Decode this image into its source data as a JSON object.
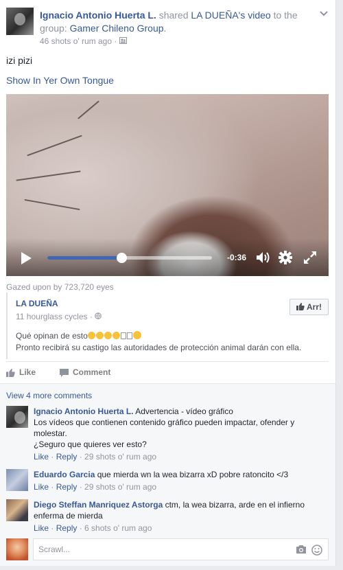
{
  "header": {
    "author": "Ignacio Antonio Huerta L.",
    "shared_word": " shared ",
    "source_name": "LA DUEÑA",
    "source_suffix": "'s video",
    "to_group_text": " to the group: ",
    "group_name": "Gamer Chileno Group",
    "period": ".",
    "timestamp": "46 shots o' rum ago",
    "separator": " · "
  },
  "post": {
    "message": "izi pizi",
    "translate_link": "Show In Yer Own Tongue"
  },
  "video": {
    "progress": 0.45,
    "time_remaining": "-0:36",
    "icons": [
      "play-icon",
      "volume-icon",
      "settings-icon",
      "fullscreen-icon"
    ]
  },
  "views": "Gazed upon by 723,720 eyes",
  "shared_post": {
    "source": "LA DUEÑA",
    "meta": "11 hourglass cycles · ",
    "like_label": "Arr!",
    "text1": "Qué opinan de esto",
    "text2": "Pronto recibirá su castigo las autoridades de protección animal darán con ella."
  },
  "actions": {
    "like": "Like",
    "comment": "Comment"
  },
  "comments": {
    "view_more": "View 4 more comments",
    "items": [
      {
        "name": "Ignacio Antonio Huerta L.",
        "line1": " Advertencia - vídeo gráfico",
        "line2": "Los vídeos que contienen contenido gráfico pueden impactar, ofender y molestar.",
        "line3": "¿Seguro que quieres ver esto?",
        "like": "Like",
        "reply": "Reply",
        "time": "29 shots o' rum ago"
      },
      {
        "name": "Eduardo Garcia",
        "text": " que mierda wn la wea bizarra xD pobre ratoncito </3",
        "like": "Like",
        "reply": "Reply",
        "time": "29 shots o' rum ago"
      },
      {
        "name": "Diego Steffan Manriquez Astorga",
        "text": " ctm, la wea bizarra, arde en el infierno enferma de mierda",
        "like": "Like",
        "reply": "Reply",
        "time": "6 shots o' rum ago"
      }
    ],
    "input_placeholder": "Scrawl...",
    "dot": " · "
  }
}
